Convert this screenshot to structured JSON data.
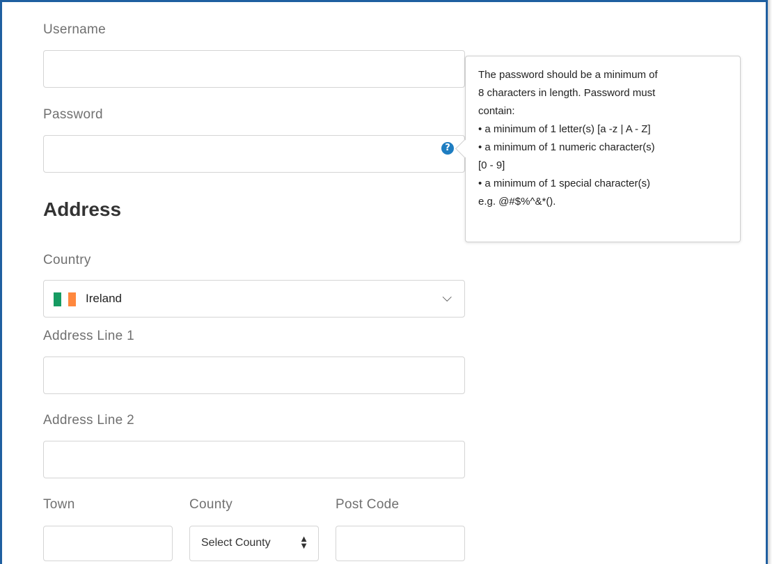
{
  "form": {
    "username_label": "Username",
    "password_label": "Password",
    "address_heading": "Address",
    "country_label": "Country",
    "country_value": "Ireland",
    "address1_label": "Address Line 1",
    "address2_label": "Address Line 2",
    "town_label": "Town",
    "county_label": "County",
    "county_select": "Select County",
    "postcode_label": "Post Code"
  },
  "tooltip": {
    "icon": "question-icon",
    "lines": [
      "The password should be a minimum of",
      "8 characters in length. Password must",
      "contain:",
      "• a minimum of 1 letter(s) [a -z | A - Z]",
      "• a minimum of 1 numeric character(s)",
      "[0 - 9]",
      "• a minimum of 1 special character(s)",
      "e.g. @#$%^&*()."
    ]
  },
  "flag_colors": [
    "#169b62",
    "#ffffff",
    "#ff883e"
  ],
  "colors": {
    "frame": "#1f5fa0",
    "help_icon": "#1e7dc1"
  }
}
